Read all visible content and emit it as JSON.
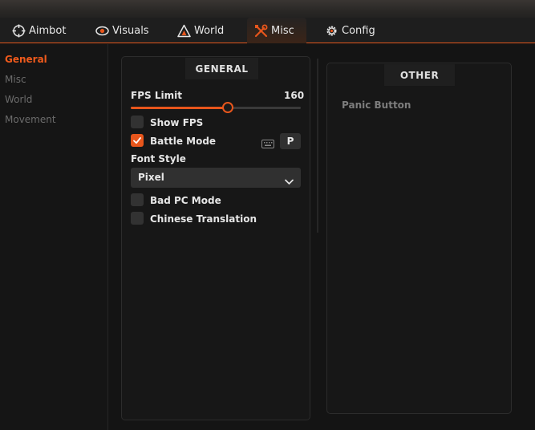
{
  "tabs": [
    {
      "label": "Aimbot",
      "icon": "crosshair-icon"
    },
    {
      "label": "Visuals",
      "icon": "eye-icon"
    },
    {
      "label": "World",
      "icon": "triangle-icon"
    },
    {
      "label": "Misc",
      "icon": "tools-icon",
      "active": true
    },
    {
      "label": "Config",
      "icon": "gear-icon"
    }
  ],
  "sidebar": {
    "items": [
      {
        "label": "General",
        "active": true
      },
      {
        "label": "Misc"
      },
      {
        "label": "World"
      },
      {
        "label": "Movement"
      }
    ]
  },
  "general": {
    "title": "GENERAL",
    "fps_limit": {
      "label": "FPS Limit",
      "value": "160",
      "fill_fraction": 0.56
    },
    "show_fps": {
      "label": "Show FPS",
      "checked": false
    },
    "battle_mode": {
      "label": "Battle Mode",
      "checked": true,
      "keybind": "P",
      "keybind_icon": "keyboard-icon"
    },
    "font_style": {
      "label": "Font Style",
      "selected": "Pixel"
    },
    "bad_pc_mode": {
      "label": "Bad PC Mode",
      "checked": false
    },
    "chinese_translation": {
      "label": "Chinese Translation",
      "checked": false
    }
  },
  "other": {
    "title": "OTHER",
    "panic_button": {
      "label": "Panic Button"
    }
  },
  "colors": {
    "accent": "#e8561c",
    "background": "#141414",
    "panel": "#171717",
    "muted_text": "#6b6b6b"
  }
}
